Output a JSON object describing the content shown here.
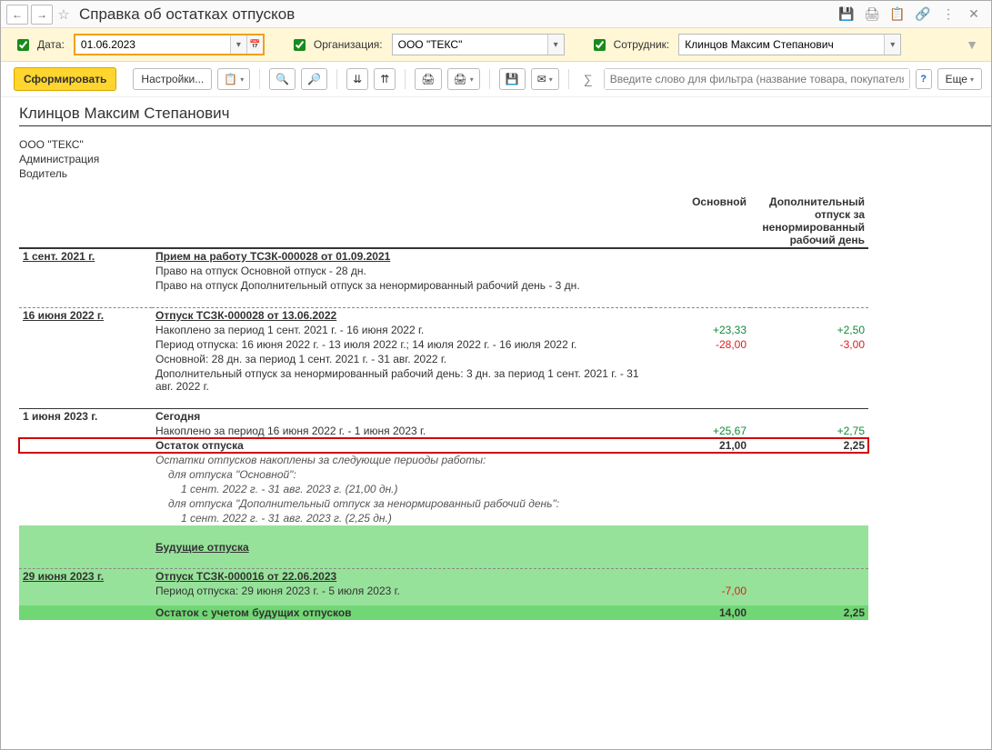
{
  "title": "Справка об остатках отпусков",
  "filter": {
    "date_label": "Дата:",
    "date_value": "01.06.2023",
    "org_label": "Организация:",
    "org_value": "ООО \"ТЕКС\"",
    "emp_label": "Сотрудник:",
    "emp_value": "Клинцов Максим Степанович"
  },
  "toolbar": {
    "form_btn": "Сформировать",
    "settings_btn": "Настройки...",
    "more_btn": "Еще",
    "search_placeholder": "Введите слово для фильтра (название товара, покупателя и ..."
  },
  "report": {
    "employee": "Клинцов Максим Степанович",
    "org": "ООО \"ТЕКС\"",
    "department": "Администрация",
    "position": "Водитель",
    "col_main": "Основной",
    "col_addl": "Дополнительный отпуск за ненормированный рабочий день",
    "rows": [
      {
        "type": "section",
        "date": "1 сент. 2021 г.",
        "title": "Прием на работу ТСЗК-000028 от 01.09.2021"
      },
      {
        "type": "line",
        "text": "Право на отпуск Основной отпуск - 28 дн."
      },
      {
        "type": "line",
        "text": "Право на отпуск Дополнительный отпуск за ненормированный рабочий день - 3 дн."
      },
      {
        "type": "spacer"
      },
      {
        "type": "section",
        "date": "16 июня 2022 г.",
        "title": "Отпуск ТСЗК-000028 от 13.06.2022"
      },
      {
        "type": "valline",
        "text": "Накоплено за период 1 сент. 2021 г. - 16 июня 2022 г.",
        "main": "+23,33",
        "main_cls": "green",
        "addl": "+2,50",
        "addl_cls": "green"
      },
      {
        "type": "valline",
        "text": "Период отпуска: 16 июня 2022 г. - 13 июля 2022 г.; 14 июля 2022 г. - 16 июля 2022 г.",
        "main": "-28,00",
        "main_cls": "red",
        "addl": "-3,00",
        "addl_cls": "red"
      },
      {
        "type": "line",
        "text": "Основной: 28 дн. за период 1 сент. 2021 г. - 31 авг. 2022 г."
      },
      {
        "type": "line",
        "text": "Дополнительный отпуск за ненормированный рабочий день: 3 дн. за период 1 сент. 2021 г. - 31 авг. 2022 г."
      },
      {
        "type": "spacer"
      },
      {
        "type": "solidsection",
        "date": "1 июня 2023 г.",
        "title": "Сегодня"
      },
      {
        "type": "valline",
        "text": "Накоплено за период 16 июня 2022 г. - 1 июня 2023 г.",
        "main": "+25,67",
        "main_cls": "green",
        "addl": "+2,75",
        "addl_cls": "green"
      },
      {
        "type": "highlight",
        "text": "Остаток отпуска",
        "main": "21,00",
        "addl": "2,25"
      },
      {
        "type": "italic",
        "text": "Остатки отпусков накоплены за следующие периоды работы:"
      },
      {
        "type": "italic-indent1",
        "text": "для отпуска \"Основной\":"
      },
      {
        "type": "italic-indent2",
        "text": "1 сент. 2022 г. - 31 авг. 2023 г. (21,00 дн.)"
      },
      {
        "type": "italic-indent1",
        "text": "для отпуска \"Дополнительный отпуск за ненормированный рабочий день\":"
      },
      {
        "type": "italic-indent2",
        "text": "1 сент. 2022 г. - 31 авг. 2023 г. (2,25 дн.)"
      },
      {
        "type": "green-spacer"
      },
      {
        "type": "green-header",
        "text": "Будущие отпуска"
      },
      {
        "type": "green-spacer"
      },
      {
        "type": "green-section",
        "date": "29 июня 2023 г.",
        "title": "Отпуск ТСЗК-000016 от 22.06.2023"
      },
      {
        "type": "green-valline",
        "text": "Период отпуска: 29 июня 2023 г. - 5 июля 2023 г.",
        "main": "-7,00",
        "main_cls": "red",
        "addl": ""
      },
      {
        "type": "green-spacer-thin"
      },
      {
        "type": "green-total",
        "text": "Остаток с учетом будущих отпусков",
        "main": "14,00",
        "addl": "2,25"
      }
    ]
  }
}
